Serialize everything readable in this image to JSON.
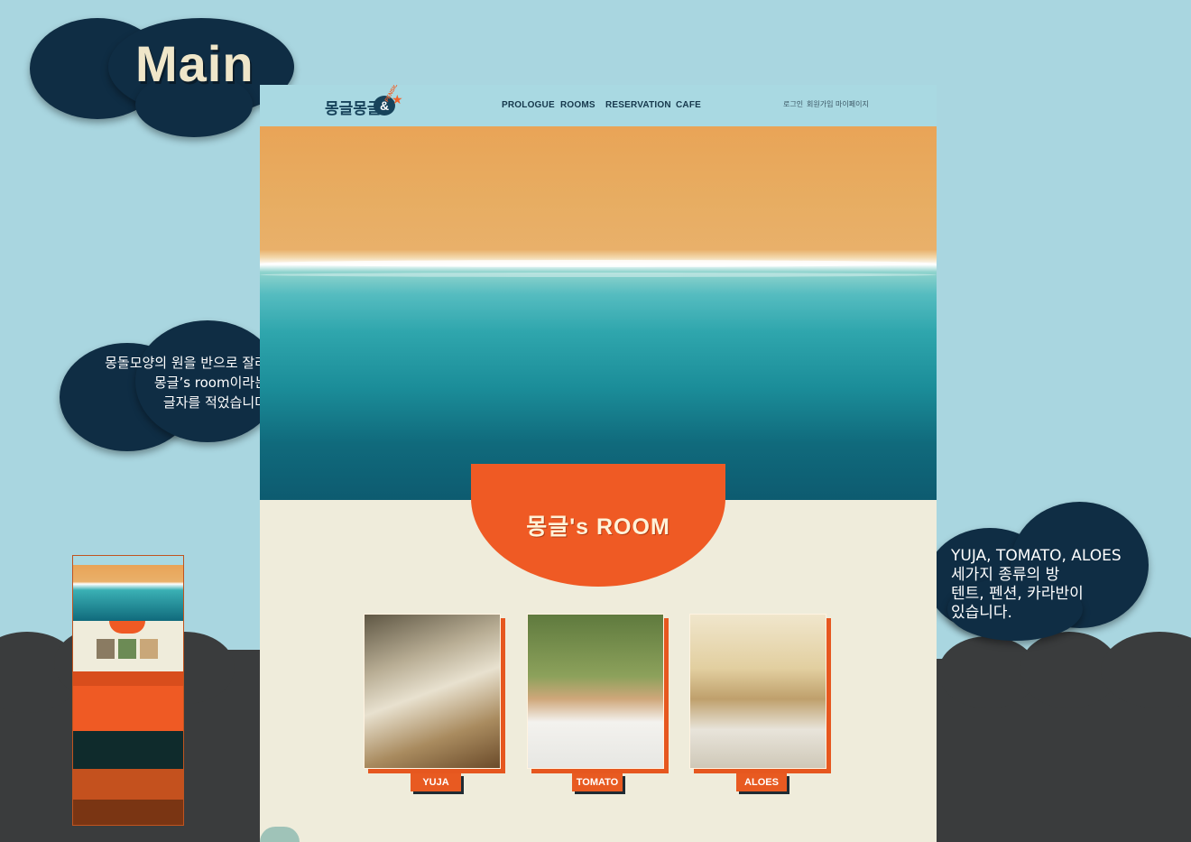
{
  "presentation": {
    "title": "Main",
    "note_left": [
      "몽돌모양의 원을 반으로 잘라",
      "몽글’s room이라는",
      "글자를 적었습니다"
    ],
    "note_right": [
      " YUJA, TOMATO, ALOES",
      "세가지 종류의 방",
      "텐트, 펜션, 카라반이",
      "있습니다."
    ]
  },
  "site": {
    "logo_text": "몽글몽글",
    "logo_amp": "&",
    "logo_badge": "PENSION",
    "nav": [
      "PROLOGUE",
      "ROOMS",
      "RESERVATION",
      "CAFE"
    ],
    "util": [
      "로그인",
      "회원가입",
      "마이페이지"
    ],
    "room_heading": "몽글's ROOM",
    "rooms": [
      {
        "label": "YUJA"
      },
      {
        "label": "TOMATO"
      },
      {
        "label": "ALOES"
      }
    ]
  },
  "colors": {
    "background": "#a9d6e0",
    "accent": "#ef5a24",
    "navy": "#0f2d44",
    "cream": "#efecdb"
  }
}
